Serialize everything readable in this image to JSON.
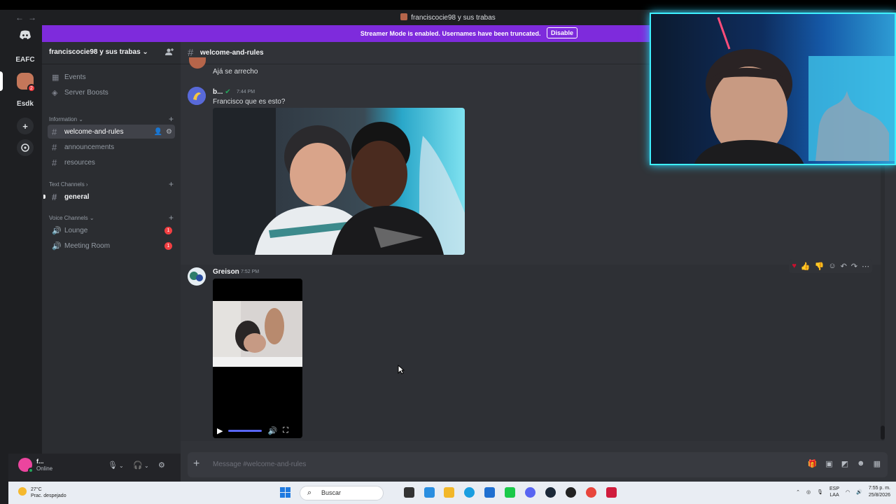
{
  "window": {
    "title": "franciscocie98 y sus trabas",
    "nav_back": "←",
    "nav_forward": "→"
  },
  "banner": {
    "text": "Streamer Mode is enabled. Usernames have been truncated.",
    "button": "Disable"
  },
  "rail": {
    "items": [
      "EAFC",
      "Esdk"
    ],
    "badge": "2"
  },
  "server": {
    "name": "franciscocie98 y sus trabas",
    "chevron": "⌄"
  },
  "sidebar": {
    "top_items": [
      "Events",
      "Server Boosts"
    ],
    "categories": {
      "information": "Information",
      "text": "Text Channels",
      "voice": "Voice Channels"
    },
    "info_channels": [
      "welcome-and-rules",
      "announcements",
      "resources"
    ],
    "text_channels": [
      "general"
    ],
    "voice_channels": [
      {
        "name": "Lounge",
        "count": "1"
      },
      {
        "name": "Meeting Room",
        "count": "1"
      }
    ]
  },
  "user": {
    "name": "f...",
    "status": "Online"
  },
  "chat": {
    "channel": "welcome-and-rules",
    "messages": [
      {
        "text": "Ajá se arrecho"
      },
      {
        "author": "b...",
        "time": "7:44 PM",
        "text": "Francisco que es esto?"
      },
      {
        "author": "Greison",
        "time": "7:52 PM"
      }
    ],
    "composer_placeholder": "Message #welcome-and-rules"
  },
  "taskbar": {
    "weather_temp": "27°C",
    "weather_desc": "Prac. despejado",
    "search": "Buscar",
    "lang1": "ESP",
    "lang2": "LAA",
    "time": "7:55 p. m.",
    "date": "25/8/2026"
  },
  "colors": {
    "banner": "#7e2bdc",
    "accent": "#5865f2",
    "danger": "#f23f42",
    "online": "#23a55a",
    "cam_border": "#3ef0ff"
  }
}
